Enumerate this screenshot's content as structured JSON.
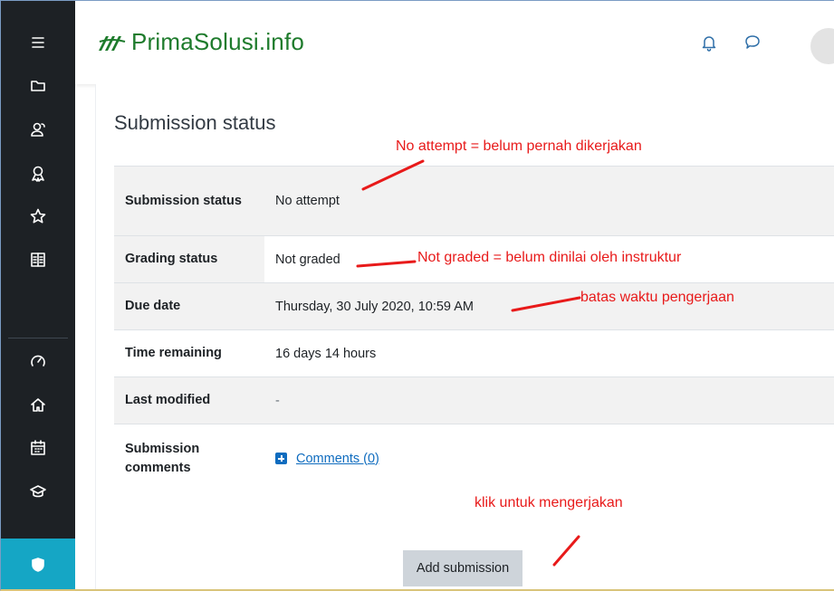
{
  "brand": {
    "name": "PrimaSolusi.info",
    "color": "#1e7b2c"
  },
  "sidebar": {
    "items": [
      {
        "icon": "menu-icon"
      },
      {
        "icon": "folder-icon"
      },
      {
        "icon": "users-icon"
      },
      {
        "icon": "badge-icon"
      },
      {
        "icon": "star-icon"
      },
      {
        "icon": "book-icon"
      },
      {
        "icon": "dashboard-icon"
      },
      {
        "icon": "home-icon"
      },
      {
        "icon": "calendar-icon"
      },
      {
        "icon": "graduation-cap-icon"
      },
      {
        "icon": "course-icon",
        "active": true
      }
    ],
    "active_color": "#15a6c5"
  },
  "topbar": {
    "icons": [
      "bell-icon",
      "chat-icon"
    ]
  },
  "main": {
    "title": "Submission status",
    "rows": [
      {
        "label": "Submission status",
        "value": "No attempt"
      },
      {
        "label": "Grading status",
        "value": "Not graded"
      },
      {
        "label": "Due date",
        "value": "Thursday, 30 July 2020, 10:59 AM"
      },
      {
        "label": "Time remaining",
        "value": "16 days 14 hours"
      },
      {
        "label": "Last modified",
        "value": "-"
      },
      {
        "label": "Submission comments",
        "value": "Comments (0)"
      }
    ],
    "add_submission_label": "Add submission"
  },
  "annotations": {
    "no_attempt": "No attempt = belum pernah dikerjakan",
    "not_graded": "Not graded = belum dinilai oleh instruktur",
    "due_date": "batas waktu pengerjaan",
    "add_submission": "klik untuk mengerjakan",
    "color": "#e81a1a"
  }
}
